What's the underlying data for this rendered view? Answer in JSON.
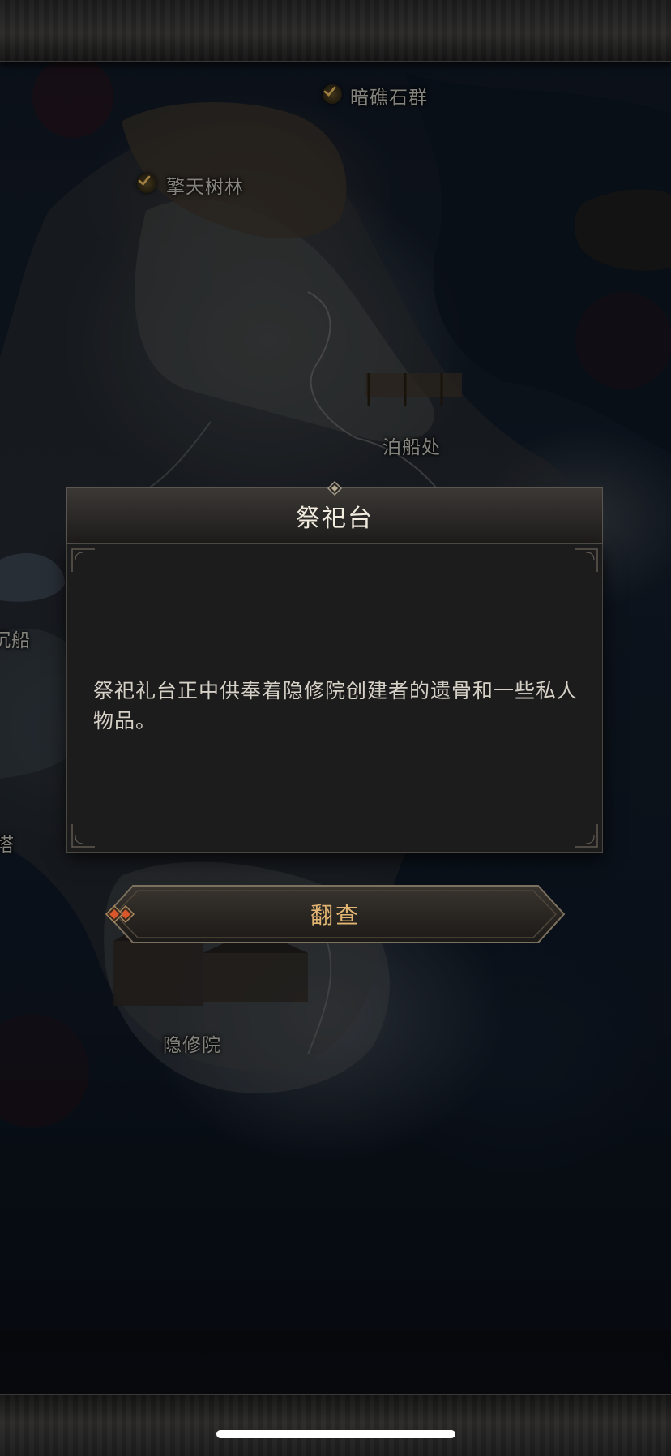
{
  "map": {
    "locations": [
      {
        "id": "reef",
        "name": "暗礁石群",
        "visited": true
      },
      {
        "id": "forest",
        "name": "擎天树林",
        "visited": true
      },
      {
        "id": "dock",
        "name": "泊船处",
        "visited": false
      },
      {
        "id": "wreck",
        "name": "沉船",
        "visited": false
      },
      {
        "id": "tower",
        "name": "塔",
        "visited": false
      },
      {
        "id": "hermitage",
        "name": "隐修院",
        "visited": false
      }
    ]
  },
  "dialog": {
    "title": "祭祀台",
    "description": "祭祀礼台正中供奉着隐修院创建者的遗骨和一些私人物品。"
  },
  "action": {
    "label": "翻查"
  },
  "colors": {
    "accent_gold": "#e3b673",
    "button_gem": "#d9572a",
    "panel_bg": "#1d1c1d"
  }
}
